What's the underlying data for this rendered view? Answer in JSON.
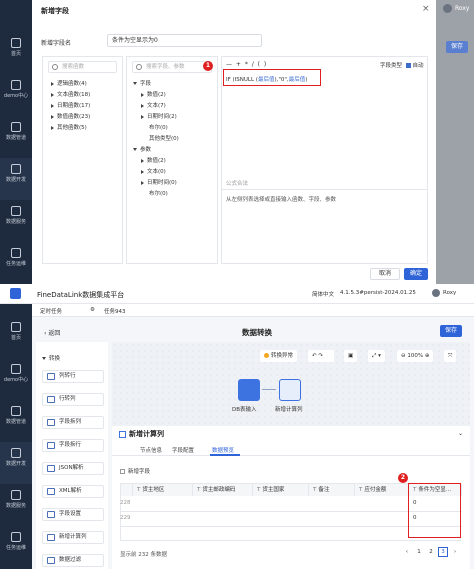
{
  "top": {
    "sidebar": [
      {
        "label": "首页",
        "icon": "home-icon"
      },
      {
        "label": "demo中心",
        "icon": "demo-icon"
      },
      {
        "label": "数据管道",
        "icon": "pipeline-icon"
      },
      {
        "label": "数据开发",
        "icon": "develop-icon"
      },
      {
        "label": "数据服务",
        "icon": "service-icon"
      },
      {
        "label": "任务运维",
        "icon": "ops-icon"
      }
    ],
    "user": "Roxy",
    "right_button": "保存",
    "dialog": {
      "title": "新增字段",
      "close": "×",
      "field_name_label": "新增字段名",
      "field_name_value": "条件为空显示为0",
      "functions_search_placeholder": "搜索函数",
      "functions": [
        "逻辑函数(4)",
        "文本函数(18)",
        "日期函数(17)",
        "数值函数(23)",
        "其他函数(5)"
      ],
      "fields_search_placeholder": "搜索字段、参数",
      "fields_tree": [
        {
          "label": "字段",
          "level": 0,
          "state": "d"
        },
        {
          "label": "数值(2)",
          "level": 1,
          "state": "r"
        },
        {
          "label": "文本(7)",
          "level": 1,
          "state": "r"
        },
        {
          "label": "日期时间(2)",
          "level": 1,
          "state": "r"
        },
        {
          "label": "布尔(0)",
          "level": 1,
          "state": "n"
        },
        {
          "label": "其他类型(0)",
          "level": 1,
          "state": "n"
        },
        {
          "label": "参数",
          "level": 0,
          "state": "d"
        },
        {
          "label": "数值(2)",
          "level": 1,
          "state": "r"
        },
        {
          "label": "文本(0)",
          "level": 1,
          "state": "r"
        },
        {
          "label": "日期时间(0)",
          "level": 1,
          "state": "r"
        },
        {
          "label": "布尔(0)",
          "level": 1,
          "state": "n"
        }
      ],
      "operators": "— + * / ( )",
      "field_type_label": "字段类型",
      "field_type_auto": "自动",
      "formula_prefix": "IF (ISNULL (",
      "formula_field1": "最后值",
      "formula_mid": "),\"0\",",
      "formula_field2": "最后值",
      "formula_suffix": ")",
      "formula_hint_label": "公式合法",
      "hint_text": "从左侧列表选择或直接输入函数、字段、参数",
      "cancel": "取消",
      "ok": "确定",
      "badge": "1"
    }
  },
  "bottom": {
    "app_title": "FineDataLink数据集成平台",
    "lang": "简体中文",
    "version": "4.1.5.3#persist-2024.01.25",
    "user": "Roxy",
    "sidebar": [
      {
        "label": "首页",
        "icon": "home-icon"
      },
      {
        "label": "demo中心",
        "icon": "demo-icon"
      },
      {
        "label": "数据管道",
        "icon": "pipeline-icon"
      },
      {
        "label": "数据开发",
        "icon": "develop-icon"
      },
      {
        "label": "数据服务",
        "icon": "service-icon"
      },
      {
        "label": "任务运维",
        "icon": "ops-icon"
      }
    ],
    "tabs": [
      {
        "label": "定时任务"
      },
      {
        "label": "任务943"
      }
    ],
    "back": "返回",
    "page_title": "数据转换",
    "save": "保存",
    "left_section": "转换",
    "components": [
      "列转行",
      "行转列",
      "字段拆列",
      "字段拆行",
      "JSON解析",
      "XML解析",
      "字段设置",
      "新增计算列",
      "数据过滤"
    ],
    "canvas": {
      "convert_anomaly": "转换异常",
      "zoom": "100%",
      "node1": "DB表输入",
      "node2": "新增计算列"
    },
    "config": {
      "title": "新增计算列",
      "tabs": [
        "节点信息",
        "字段配置",
        "数据预览"
      ],
      "add_field": "新增字段",
      "columns": [
        "货主地区",
        "货主邮政编码",
        "货主国家",
        "备注",
        "应付金额",
        "条件为空显..."
      ],
      "rows": [
        {
          "num": "228",
          "values": [
            "",
            "",
            "",
            "",
            "",
            "0"
          ]
        },
        {
          "num": "229",
          "values": [
            "",
            "",
            "",
            "",
            "",
            "0"
          ]
        }
      ],
      "pager_text": "显示前 232 条数据",
      "pages": [
        "1",
        "2",
        "3"
      ],
      "current_page": "3",
      "badge": "2"
    }
  }
}
